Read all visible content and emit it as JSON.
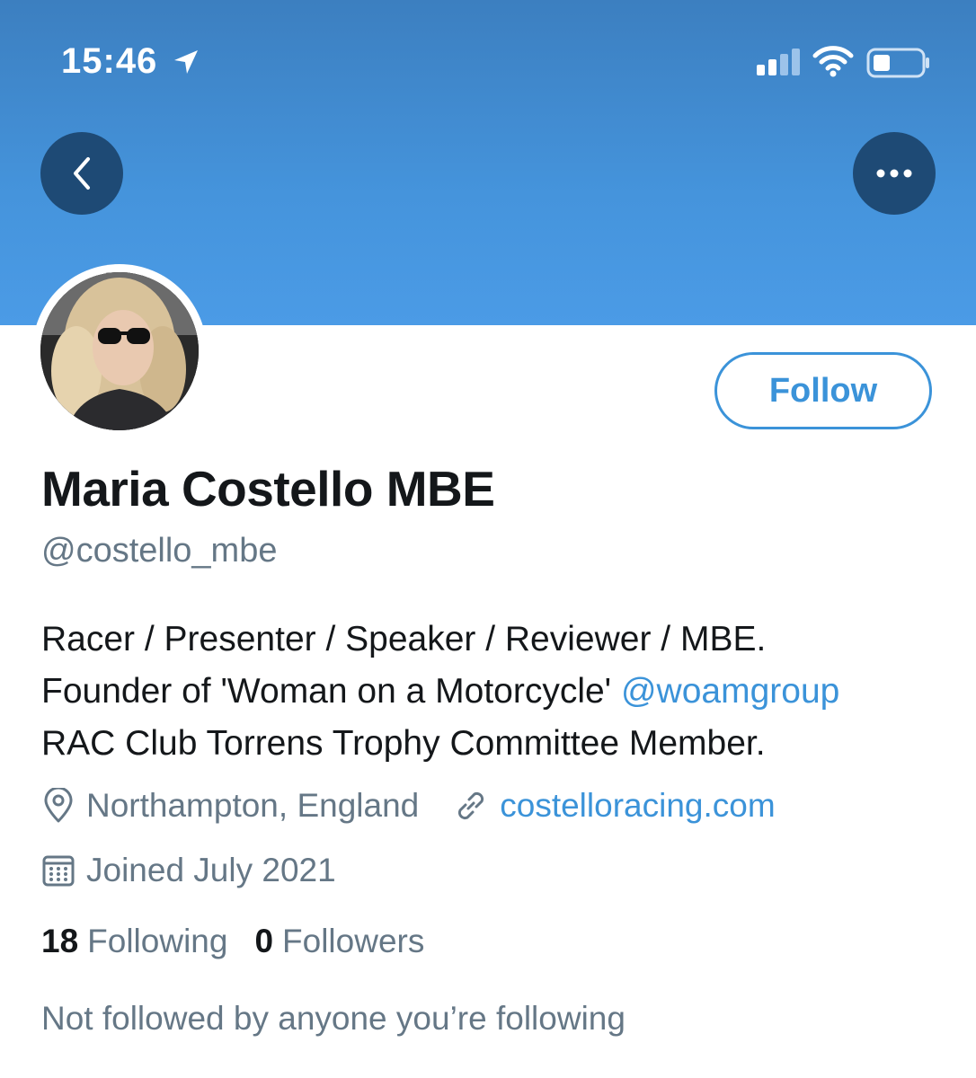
{
  "status_bar": {
    "time": "15:46",
    "icons": [
      "location-arrow-icon",
      "signal-icon",
      "wifi-icon",
      "battery-icon"
    ]
  },
  "header": {
    "back_icon": "chevron-left-icon",
    "more_icon": "more-horizontal-icon",
    "banner_color": "#4594dc"
  },
  "profile": {
    "follow_label": "Follow",
    "name": "Maria Costello MBE",
    "handle": "@costello_mbe",
    "bio": {
      "line1": "Racer / Presenter / Speaker / Reviewer / MBE.",
      "line2_text": "Founder of 'Woman on a Motorcycle' ",
      "line2_mention": "@woamgroup",
      "line3": "RAC Club Torrens Trophy Committee Member."
    },
    "location": "Northampton, England",
    "website": "costelloracing.com",
    "joined": "Joined July 2021",
    "following_count": "18",
    "following_label": "Following",
    "followers_count": "0",
    "followers_label": "Followers",
    "mutuals": "Not followed by anyone you’re following"
  },
  "colors": {
    "accent": "#3b93d9",
    "text_primary": "#14171a",
    "text_secondary": "#657786",
    "button_dark": "#1e4a75"
  }
}
